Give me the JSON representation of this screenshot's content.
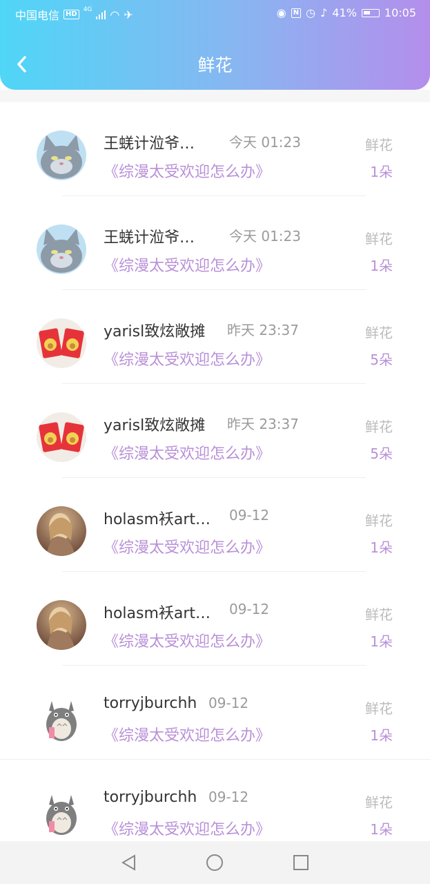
{
  "status_bar": {
    "carrier": "中国电信",
    "hd": "HD",
    "net": "4G",
    "battery": "41%",
    "time": "10:05"
  },
  "header": {
    "title": "鲜花"
  },
  "items": [
    {
      "name": "王蜣计涖爷…",
      "time": "今天 01:23",
      "work": "《综漫太受欢迎怎么办》",
      "type": "鲜花",
      "count": "1朵",
      "avatar": "cat"
    },
    {
      "name": "王蜣计涖爷…",
      "time": "今天 01:23",
      "work": "《综漫太受欢迎怎么办》",
      "type": "鲜花",
      "count": "1朵",
      "avatar": "cat"
    },
    {
      "name": "yarisl致炫敞摊",
      "time": "昨天 23:37",
      "work": "《综漫太受欢迎怎么办》",
      "type": "鲜花",
      "count": "5朵",
      "avatar": "redbag"
    },
    {
      "name": "yarisl致炫敞摊",
      "time": "昨天 23:37",
      "work": "《综漫太受欢迎怎么办》",
      "type": "鲜花",
      "count": "5朵",
      "avatar": "redbag"
    },
    {
      "name": "holasm袄art…",
      "time": "09-12",
      "work": "《综漫太受欢迎怎么办》",
      "type": "鲜花",
      "count": "1朵",
      "avatar": "girl"
    },
    {
      "name": "holasm袄art…",
      "time": "09-12",
      "work": "《综漫太受欢迎怎么办》",
      "type": "鲜花",
      "count": "1朵",
      "avatar": "girl"
    },
    {
      "name": "torryjburchh",
      "time": "09-12",
      "work": "《综漫太受欢迎怎么办》",
      "type": "鲜花",
      "count": "1朵",
      "avatar": "totoro"
    },
    {
      "name": "torryjburchh",
      "time": "09-12",
      "work": "《综漫太受欢迎怎么办》",
      "type": "鲜花",
      "count": "1朵",
      "avatar": "totoro"
    }
  ],
  "colors": {
    "accent_purple": "#b990d8",
    "header_start": "#4fd6f7",
    "header_end": "#b48eec"
  }
}
